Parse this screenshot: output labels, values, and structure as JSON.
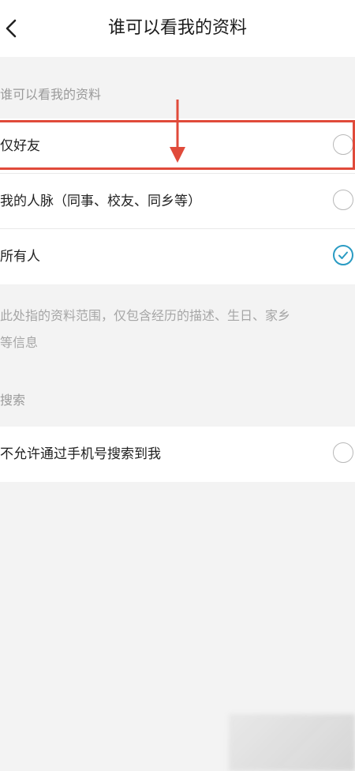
{
  "header": {
    "title": "谁可以看我的资料"
  },
  "profile_visibility": {
    "section_title": "谁可以看我的资料",
    "options": [
      {
        "label": "仅好友",
        "checked": false
      },
      {
        "label": "我的人脉（同事、校友、同乡等）",
        "checked": false
      },
      {
        "label": "所有人",
        "checked": true
      }
    ],
    "note_line1": "此处指的资料范围，仅包含经历的描述、生日、家乡",
    "note_line2": "等信息"
  },
  "search": {
    "section_title": "搜索",
    "options": [
      {
        "label": "不允许通过手机号搜索到我",
        "checked": false
      }
    ]
  },
  "colors": {
    "accent": "#2a9bc3",
    "annotation": "#e04a3a",
    "background": "#f3f3f3"
  },
  "icons": {
    "back": "chevron-left-icon",
    "radio_checked": "check-icon"
  }
}
